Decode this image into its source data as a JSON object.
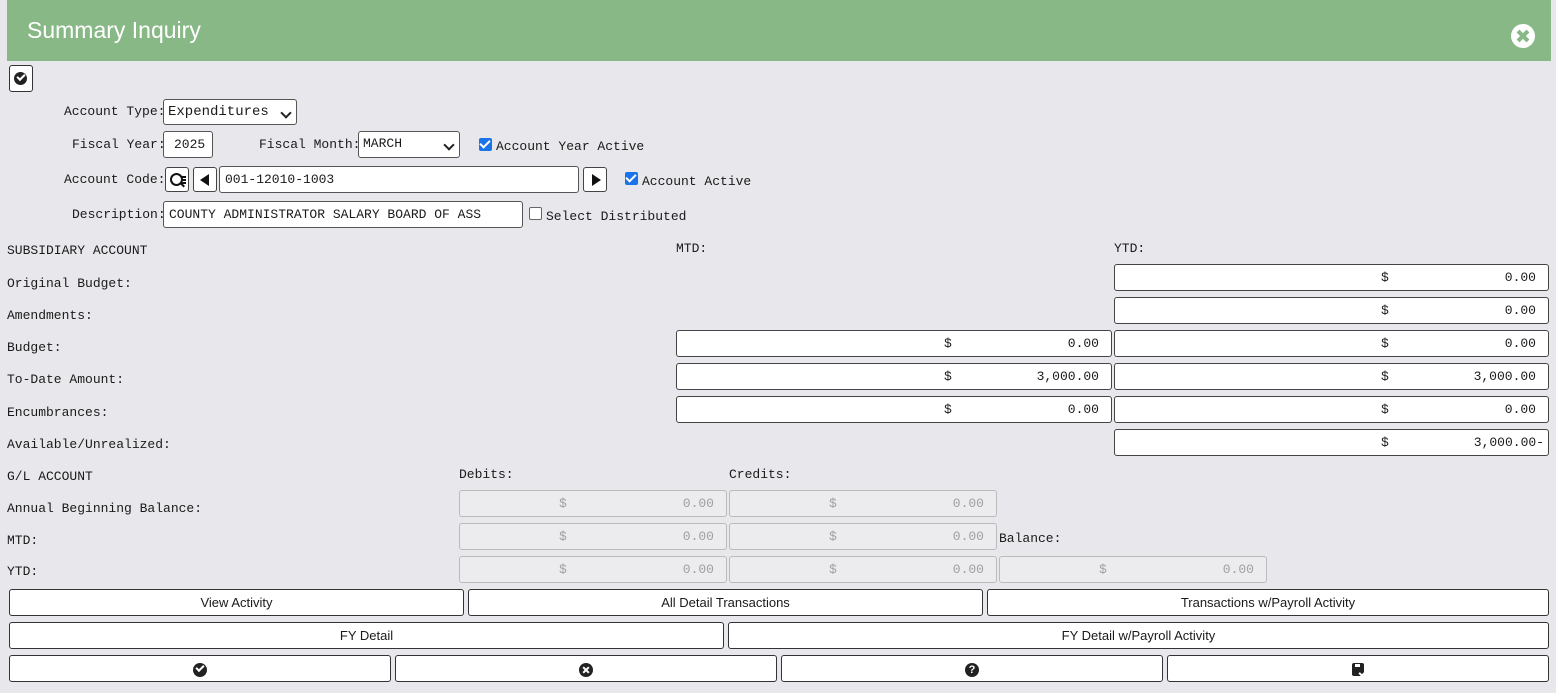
{
  "window": {
    "title": "Summary Inquiry",
    "close_icon": "close-circle-icon"
  },
  "toolbar": {
    "toggle_icon": "check-circle-icon"
  },
  "form": {
    "account_type_label": "Account Type:",
    "account_type_value": "Expenditures",
    "fiscal_year_label": "Fiscal Year:",
    "fiscal_year_value": "2025",
    "fiscal_month_label": "Fiscal Month:",
    "fiscal_month_value": "MARCH",
    "account_year_active_label": "Account Year Active",
    "account_year_active_checked": true,
    "account_code_label": "Account Code:",
    "account_code_value": "001-12010-1003",
    "account_active_label": "Account Active",
    "account_active_checked": true,
    "description_label": "Description:",
    "description_value": "COUNTY ADMINISTRATOR SALARY BOARD OF ASS",
    "select_distributed_label": "Select Distributed",
    "select_distributed_checked": false
  },
  "subsidiary": {
    "heading": "SUBSIDIARY ACCOUNT",
    "mtd_header": "MTD:",
    "ytd_header": "YTD:",
    "currency": "$",
    "original_budget": {
      "label": "Original Budget:",
      "ytd": "0.00"
    },
    "amendments": {
      "label": "Amendments:",
      "ytd": "0.00"
    },
    "budget": {
      "label": "Budget:",
      "mtd": "0.00",
      "ytd": "0.00"
    },
    "to_date": {
      "label": "To-Date Amount:",
      "mtd": "3,000.00",
      "ytd": "3,000.00"
    },
    "encumbrances": {
      "label": "Encumbrances:",
      "mtd": "0.00",
      "ytd": "0.00"
    },
    "available": {
      "label": "Available/Unrealized:",
      "ytd": "3,000.00-"
    }
  },
  "gl": {
    "heading": "G/L ACCOUNT",
    "debits_header": "Debits:",
    "credits_header": "Credits:",
    "balance_header": "Balance:",
    "currency": "$",
    "annual_beginning": {
      "label": "Annual Beginning Balance:",
      "debit": "0.00",
      "credit": "0.00"
    },
    "mtd": {
      "label": "MTD:",
      "debit": "0.00",
      "credit": "0.00"
    },
    "ytd": {
      "label": "YTD:",
      "debit": "0.00",
      "credit": "0.00",
      "balance": "0.00"
    }
  },
  "actions": {
    "view_activity": "View Activity",
    "all_detail": "All Detail Transactions",
    "payroll_activity": "Transactions w/Payroll Activity",
    "fy_detail": "FY Detail",
    "fy_detail_payroll": "FY Detail w/Payroll Activity"
  },
  "footer_icons": [
    "check-circle-icon",
    "close-circle-icon",
    "question-circle-icon",
    "save-icon"
  ]
}
